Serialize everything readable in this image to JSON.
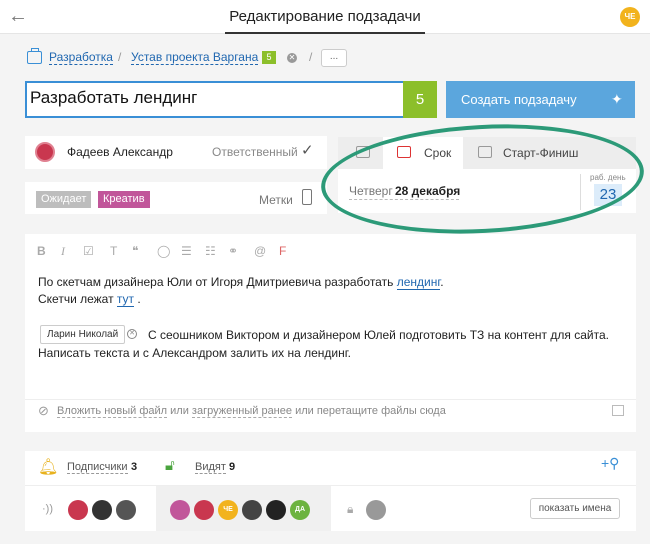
{
  "header": {
    "title": "Редактирование подзадачи",
    "user_initials": "ЧЕ"
  },
  "breadcrumb": {
    "project": "Разработка",
    "parent_task": "Устав проекта Варгана",
    "parent_count": "5",
    "more": "..."
  },
  "task": {
    "title": "Разработать лендинг",
    "title_count": "5",
    "create_subtask_label": "Создать подзадачу"
  },
  "responsible": {
    "name": "Фадеев Александр",
    "role": "Ответственный"
  },
  "tags": {
    "items": [
      {
        "label": "Ожидает",
        "color": "#bdbdbd"
      },
      {
        "label": "Креатив",
        "color": "#c1569a"
      }
    ],
    "label": "Метки"
  },
  "deadline": {
    "tabs": [
      {
        "label": "Срок"
      },
      {
        "label": "Старт-Финиш"
      }
    ],
    "day": "Четверг",
    "date": "28 декабря",
    "workdays_label": "раб. день",
    "workdays": "23"
  },
  "editor": {
    "toolbar": [
      "B",
      "I",
      "☑",
      "T",
      "❝",
      "◯",
      "☰",
      "☷",
      "⚭",
      "@",
      "F"
    ],
    "line1_before": "По скетчам дизайнера Юли от Игоря Дмитриевича разработать ",
    "line1_link": "лендинг",
    "line1_after": ".",
    "line2_before": "Скетчи лежат ",
    "line2_link": "тут",
    "line2_after": " .",
    "mention": "Ларин Николай",
    "line3": "С сеошником Виктором и дизайнером Юлей подготовить ТЗ на контент для сайта.",
    "line4": "Написать текста и с Александром залить их на лендинг."
  },
  "attachments": {
    "attach_new": "Вложить новый файл",
    "or1": "или",
    "uploaded": "загруженный ранее",
    "or2": "или",
    "drag": "перетащите файлы сюда"
  },
  "footer": {
    "subscribers_label": "Подписчики",
    "subscribers_count": "3",
    "visible_label": "Видят",
    "visible_count": "9",
    "show_names": "показать имена",
    "avatar_initials": [
      "ЧЕ",
      "ДА"
    ]
  },
  "colors": {
    "accent": "#3a8fd6",
    "green": "#8cbf2a",
    "button": "#5ba6dd",
    "annotation": "#2c9a78"
  }
}
